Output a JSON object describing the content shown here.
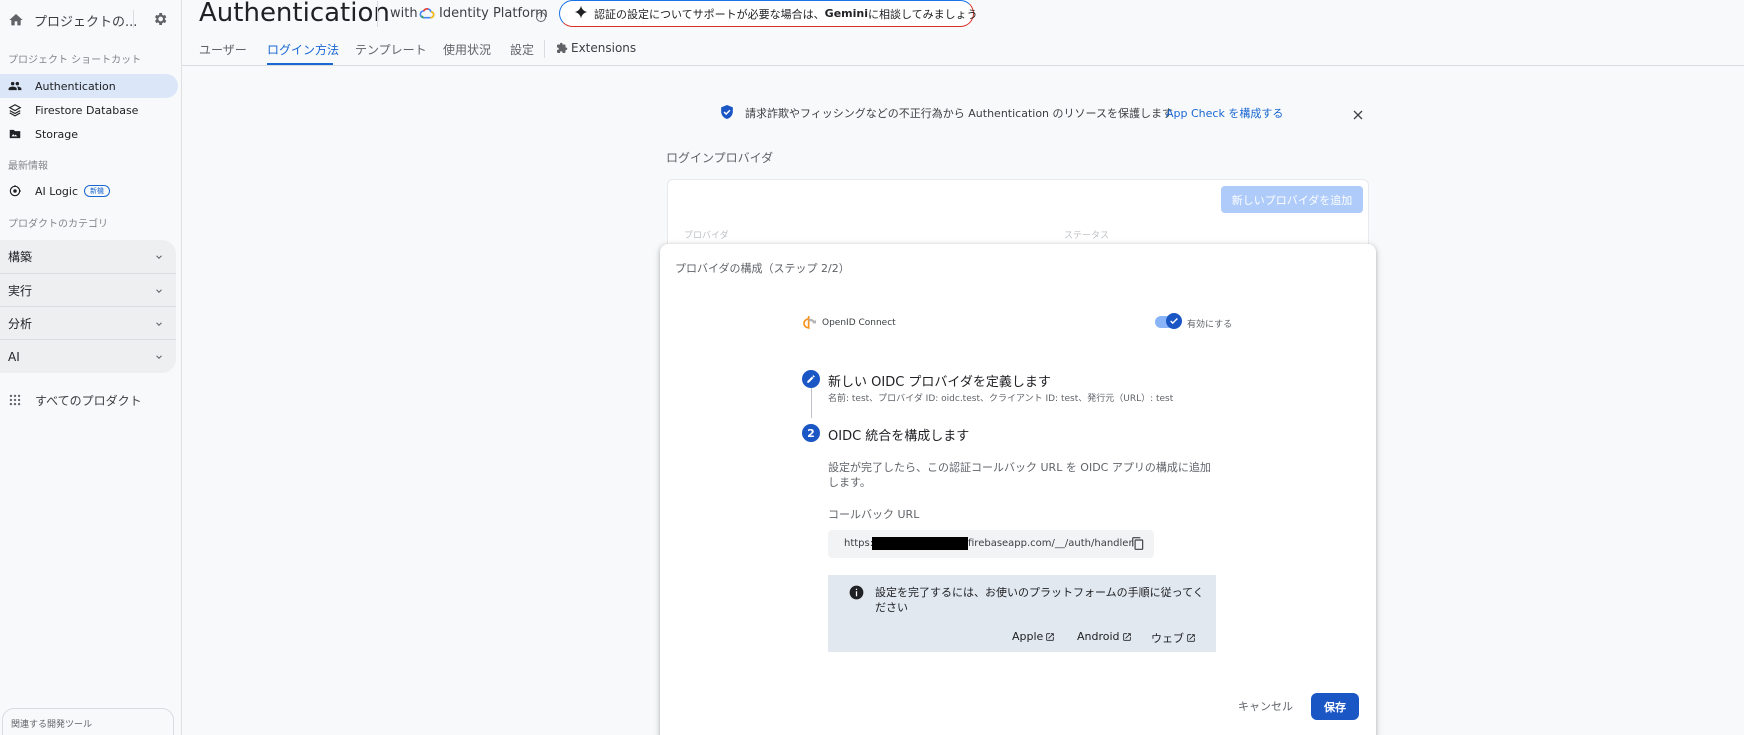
{
  "sidebar": {
    "project_name": "プロジェクトの...",
    "shortcuts_title": "プロジェクト ショートカット",
    "shortcuts": [
      {
        "label": "Authentication",
        "icon": "people-icon"
      },
      {
        "label": "Firestore Database",
        "icon": "firestore-icon"
      },
      {
        "label": "Storage",
        "icon": "storage-folder-icon"
      }
    ],
    "whats_new_title": "最新情報",
    "ai_logic_label": "AI Logic",
    "ai_logic_badge": "新機",
    "categories_title": "プロダクトのカテゴリ",
    "categories": [
      {
        "label": "構築"
      },
      {
        "label": "実行"
      },
      {
        "label": "分析"
      },
      {
        "label": "AI"
      }
    ],
    "all_products_label": "すべてのプロダクト",
    "dev_tools_label": "関連する開発ツール"
  },
  "header": {
    "title": "Authentication",
    "with_label": "with",
    "platform_label": "Identity Platform",
    "gemini_prefix": "認証の設定についてサポートが必要な場合は、",
    "gemini_name": "Gemini",
    "gemini_suffix": " に相談してみましょう"
  },
  "tabs": [
    {
      "label": "ユーザー"
    },
    {
      "label": "ログイン方法"
    },
    {
      "label": "テンプレート"
    },
    {
      "label": "使用状況"
    },
    {
      "label": "設定"
    },
    {
      "label": "Extensions"
    }
  ],
  "banner": {
    "text": "請求詐欺やフィッシングなどの不正行為から Authentication のリソースを保護します",
    "link": "App Check を構成する"
  },
  "providers": {
    "title": "ログインプロバイダ",
    "add_button": "新しいプロバイダを追加",
    "col_provider": "プロバイダ",
    "col_status": "ステータス"
  },
  "dialog": {
    "title": "プロバイダの構成（ステップ 2/2）",
    "provider_name": "OpenID Connect",
    "enable_label": "有効にする",
    "step1_title": "新しい OIDC プロバイダを定義します",
    "step1_desc": "名前: test、プロバイダ ID: oidc.test、クライアント ID: test、発行元（URL）: test",
    "step2_number": "2",
    "step2_title": "OIDC 統合を構成します",
    "step2_desc": "設定が完了したら、この認証コールバック URL を OIDC アプリの構成に追加します。",
    "callback_label": "コールバック URL",
    "callback_url_prefix": "https://",
    "callback_url_suffix": "firebaseapp.com/__/auth/handler",
    "info_text": "設定を完了するには、お使いのプラットフォームの手順に従ってください",
    "platform_links": [
      {
        "label": "Apple"
      },
      {
        "label": "Android"
      },
      {
        "label": "ウェブ"
      }
    ],
    "cancel_label": "キャンセル",
    "save_label": "保存"
  },
  "colors": {
    "accent": "#1967d2",
    "active_nav_bg": "#dbe6f8",
    "primary_button": "#1a56c4"
  }
}
